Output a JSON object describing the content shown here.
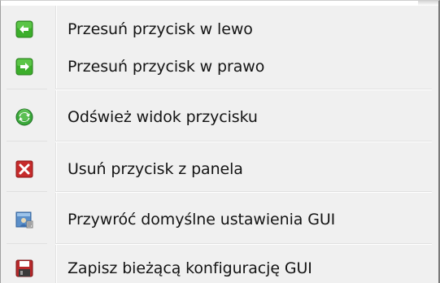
{
  "context_menu": {
    "items": [
      {
        "label": "Przesuń przycisk w lewo",
        "icon": "arrow-left-icon"
      },
      {
        "label": "Przesuń przycisk w prawo",
        "icon": "arrow-right-icon"
      },
      {
        "label": "Odśwież widok przycisku",
        "icon": "refresh-icon"
      },
      {
        "label": "Usuń przycisk z panela",
        "icon": "delete-icon"
      },
      {
        "label": "Przywróć domyślne ustawienia GUI",
        "icon": "restore-settings-icon"
      },
      {
        "label": "Zapisz bieżącą konfigurację GUI",
        "icon": "save-icon"
      }
    ]
  },
  "colors": {
    "menu_background": "#f0f0f0",
    "arrow_green": "#3cae2b",
    "delete_red": "#c62b2b",
    "save_red": "#b8292b",
    "text": "#141414"
  }
}
